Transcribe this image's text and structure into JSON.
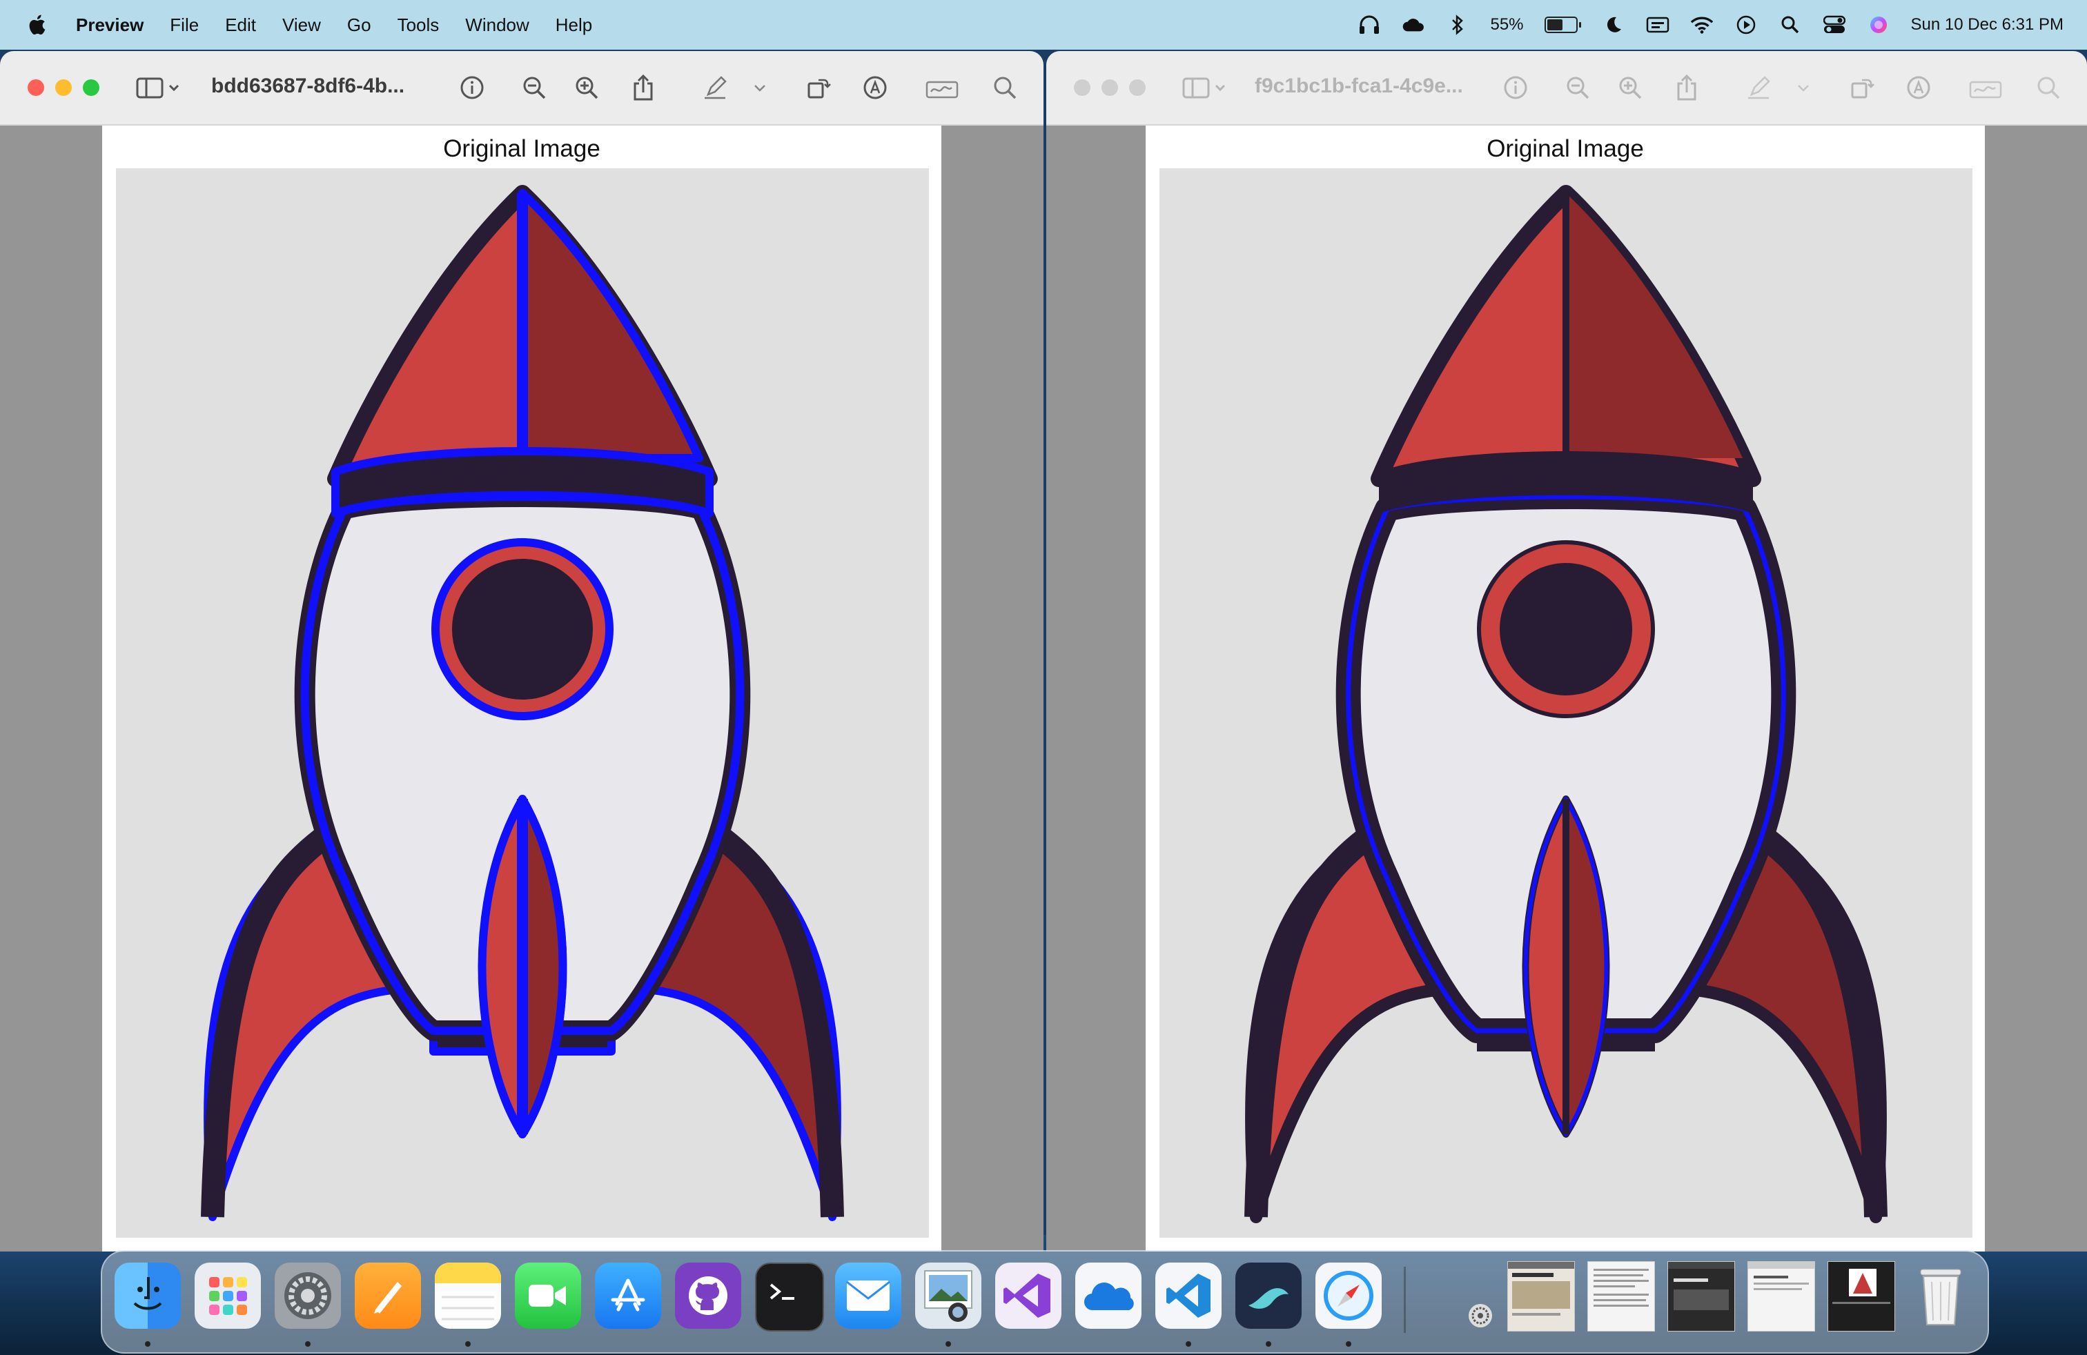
{
  "menubar": {
    "app_name": "Preview",
    "menus": [
      "File",
      "Edit",
      "View",
      "Go",
      "Tools",
      "Window",
      "Help"
    ],
    "battery_percent_label": "55%",
    "battery_level": 0.55,
    "datetime": "Sun 10 Dec  6:31 PM"
  },
  "windows": [
    {
      "title": "bdd63687-8df6-4b...",
      "active": true,
      "page_title": "Original Image",
      "rocket_outline_color": "#1010ff"
    },
    {
      "title": "f9c1bc1b-fca1-4c9e...",
      "active": false,
      "page_title": "Original Image",
      "rocket_outline_color": "#1010ff"
    }
  ],
  "colors": {
    "menubar_bg": "#b6dcec",
    "rocket_red_light": "#cc4240",
    "rocket_red_dark": "#8e2a2b",
    "rocket_navy": "#271c33",
    "rocket_body": "#e8e8ec",
    "highlight_blue": "#1010ff",
    "traffic_close": "#fe5f57",
    "traffic_min": "#febc2e",
    "traffic_max": "#28c840"
  },
  "dock": {
    "apps": [
      "finder-icon",
      "launchpad-icon",
      "system-settings-icon",
      "pages-icon",
      "notes-icon",
      "facetime-icon",
      "app-store-icon",
      "github-desktop-icon",
      "terminal-icon",
      "mail-icon",
      "preview-icon",
      "visual-studio-icon",
      "onedrive-icon",
      "vscode-icon",
      "mendeley-icon",
      "safari-icon"
    ]
  }
}
